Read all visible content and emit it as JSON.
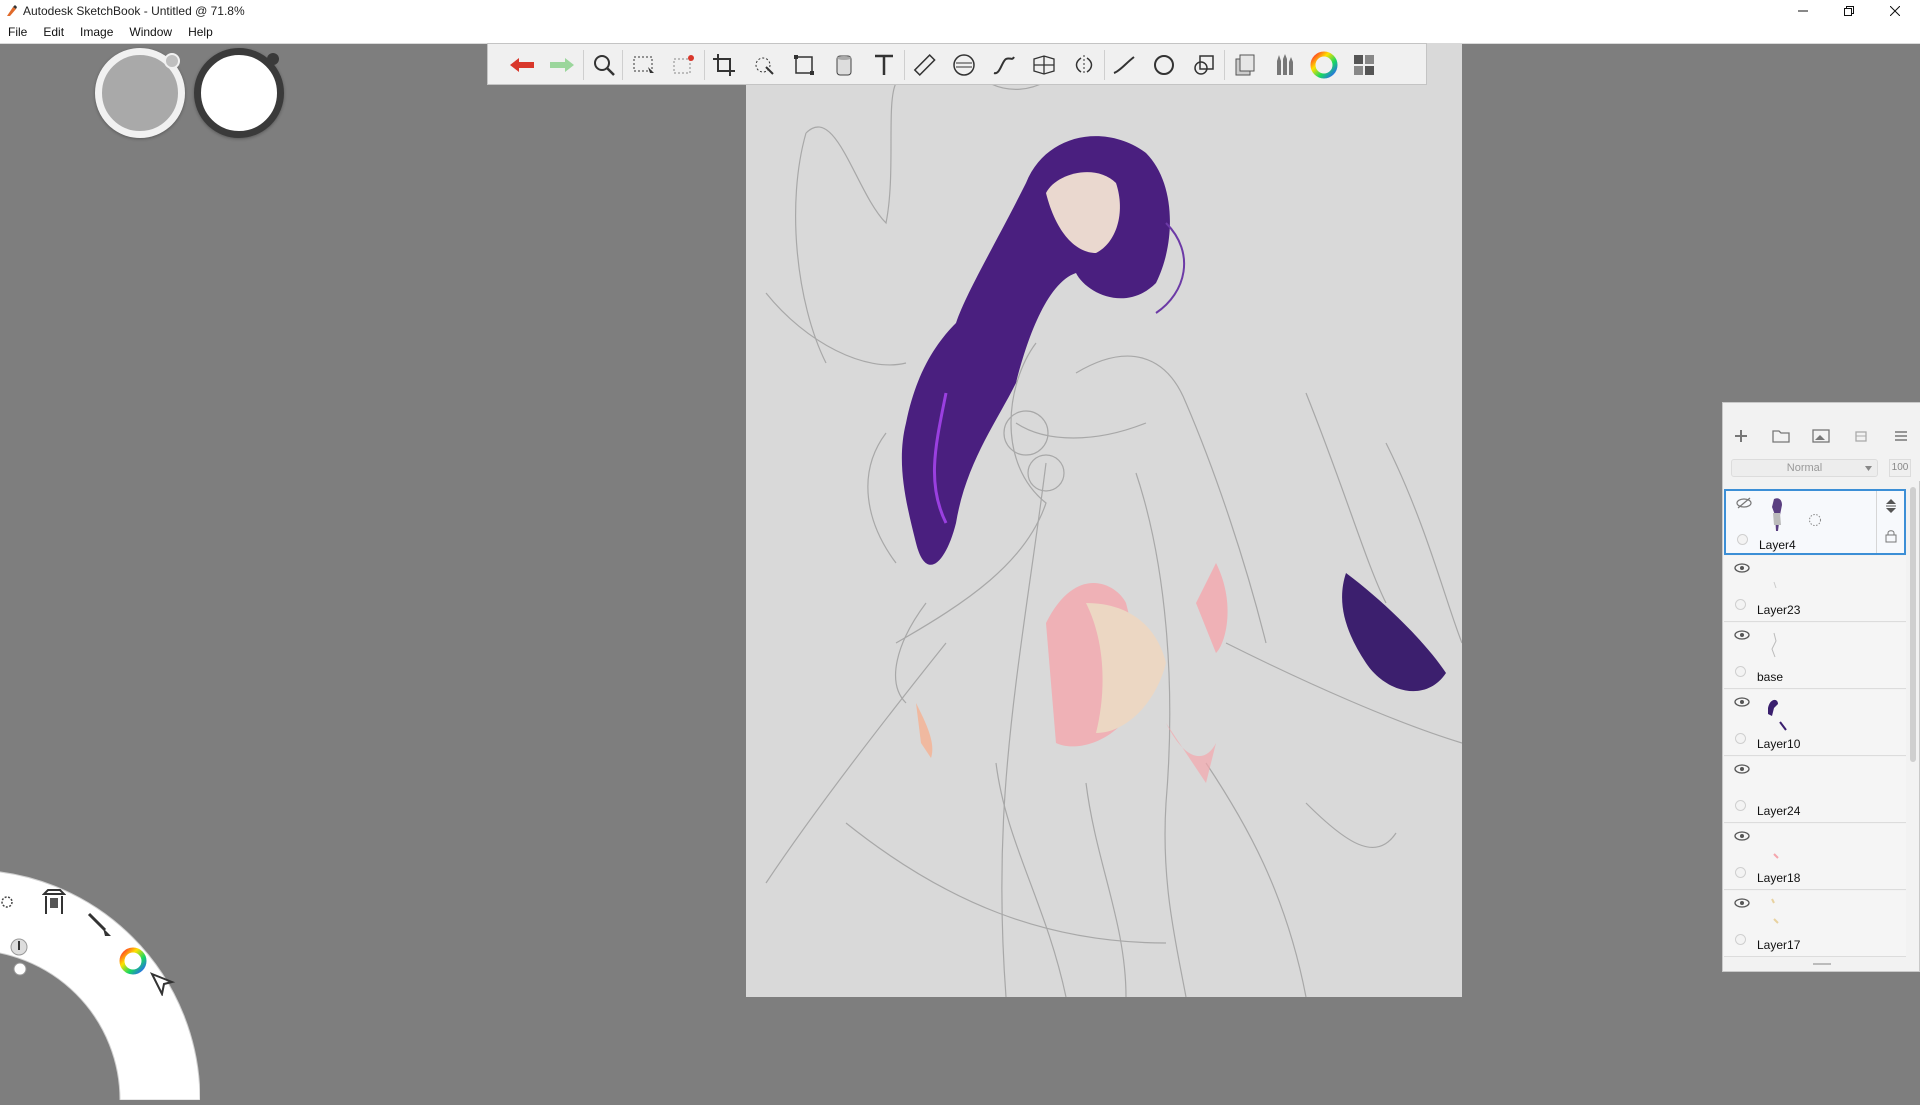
{
  "window": {
    "title": "Autodesk SketchBook - Untitled @ 71.8%"
  },
  "menu": [
    "File",
    "Edit",
    "Image",
    "Window",
    "Help"
  ],
  "toolbar": {
    "tools": [
      "undo-icon",
      "redo-icon",
      "zoom-icon",
      "select-icon",
      "lasso-cut-icon",
      "crop-icon",
      "magic-wand-icon",
      "transform-icon",
      "fill-icon",
      "text-icon",
      "ruler-icon",
      "ellipse-guide-icon",
      "french-curve-icon",
      "perspective-icon",
      "symmetry-icon",
      "line-icon",
      "oval-icon",
      "shape-icon",
      "copy-icon",
      "brush-library-icon",
      "color-wheel-icon",
      "layout-icon"
    ]
  },
  "pucks": {
    "left": "grey-puck",
    "right": "white-puck"
  },
  "layers_panel": {
    "blend_mode": "Normal",
    "opacity": "100",
    "layers": [
      {
        "name": "Layer4",
        "active": true,
        "visible": false
      },
      {
        "name": "Layer23",
        "active": false,
        "visible": true
      },
      {
        "name": "base",
        "active": false,
        "visible": true
      },
      {
        "name": "Layer10",
        "active": false,
        "visible": true
      },
      {
        "name": "Layer24",
        "active": false,
        "visible": true
      },
      {
        "name": "Layer18",
        "active": false,
        "visible": true
      },
      {
        "name": "Layer17",
        "active": false,
        "visible": true
      }
    ]
  },
  "colors": {
    "accent": "#3c8fd6",
    "background": "#7e7e7e",
    "paper": "#d9d9d9",
    "undo": "#d9372b",
    "redo": "#9bd69c"
  }
}
